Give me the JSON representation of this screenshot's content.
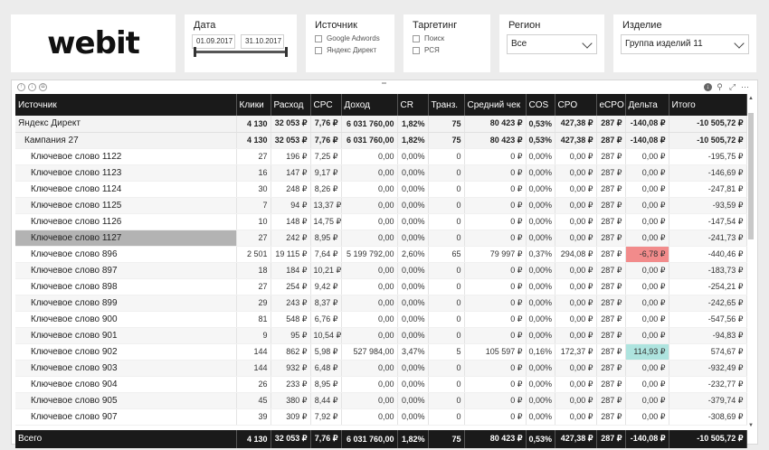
{
  "logo": {
    "text": "webit"
  },
  "date_slicer": {
    "title": "Дата",
    "start": "01.09.2017",
    "end": "31.10.2017"
  },
  "source_slicer": {
    "title": "Источник",
    "options": [
      "Google Adwords",
      "Яндекс Директ"
    ]
  },
  "targeting_slicer": {
    "title": "Таргетинг",
    "options": [
      "Поиск",
      "РСЯ"
    ]
  },
  "region_slicer": {
    "title": "Регион",
    "value": "Все"
  },
  "product_slicer": {
    "title": "Изделие",
    "value": "Группа изделий 11"
  },
  "colors": {
    "header_bg": "#1a1a1a",
    "negative_highlight": "#f28b8b",
    "positive_highlight": "#aee4df",
    "selected_row": "#b3b3b3"
  },
  "table": {
    "columns": [
      "Источник",
      "Клики",
      "Расход",
      "CPC",
      "Доход",
      "CR",
      "Транз.",
      "Средний чек",
      "COS",
      "CPO",
      "eCPO",
      "Дельта",
      "Итого"
    ],
    "rows": [
      {
        "level": 0,
        "cells": [
          "Яндекс Директ",
          "4 130",
          "32 053 ₽",
          "7,76 ₽",
          "6 031 760,00",
          "1,82%",
          "75",
          "80 423 ₽",
          "0,53%",
          "427,38 ₽",
          "287 ₽",
          "-140,08 ₽",
          "-10 505,72 ₽"
        ]
      },
      {
        "level": 1,
        "cells": [
          "Кампания 27",
          "4 130",
          "32 053 ₽",
          "7,76 ₽",
          "6 031 760,00",
          "1,82%",
          "75",
          "80 423 ₽",
          "0,53%",
          "427,38 ₽",
          "287 ₽",
          "-140,08 ₽",
          "-10 505,72 ₽"
        ]
      },
      {
        "level": 2,
        "cells": [
          "Ключевое слово 1122",
          "27",
          "196 ₽",
          "7,25 ₽",
          "0,00",
          "0,00%",
          "0",
          "0 ₽",
          "0,00%",
          "0,00 ₽",
          "287 ₽",
          "0,00 ₽",
          "-195,75 ₽"
        ]
      },
      {
        "level": 2,
        "cells": [
          "Ключевое слово 1123",
          "16",
          "147 ₽",
          "9,17 ₽",
          "0,00",
          "0,00%",
          "0",
          "0 ₽",
          "0,00%",
          "0,00 ₽",
          "287 ₽",
          "0,00 ₽",
          "-146,69 ₽"
        ]
      },
      {
        "level": 2,
        "cells": [
          "Ключевое слово 1124",
          "30",
          "248 ₽",
          "8,26 ₽",
          "0,00",
          "0,00%",
          "0",
          "0 ₽",
          "0,00%",
          "0,00 ₽",
          "287 ₽",
          "0,00 ₽",
          "-247,81 ₽"
        ]
      },
      {
        "level": 2,
        "cells": [
          "Ключевое слово 1125",
          "7",
          "94 ₽",
          "13,37 ₽",
          "0,00",
          "0,00%",
          "0",
          "0 ₽",
          "0,00%",
          "0,00 ₽",
          "287 ₽",
          "0,00 ₽",
          "-93,59 ₽"
        ]
      },
      {
        "level": 2,
        "cells": [
          "Ключевое слово 1126",
          "10",
          "148 ₽",
          "14,75 ₽",
          "0,00",
          "0,00%",
          "0",
          "0 ₽",
          "0,00%",
          "0,00 ₽",
          "287 ₽",
          "0,00 ₽",
          "-147,54 ₽"
        ]
      },
      {
        "level": 2,
        "selected": true,
        "cells": [
          "Ключевое слово 1127",
          "27",
          "242 ₽",
          "8,95 ₽",
          "0,00",
          "0,00%",
          "0",
          "0 ₽",
          "0,00%",
          "0,00 ₽",
          "287 ₽",
          "0,00 ₽",
          "-241,73 ₽"
        ]
      },
      {
        "level": 2,
        "highlight": "neg",
        "cells": [
          "Ключевое слово 896",
          "2 501",
          "19 115 ₽",
          "7,64 ₽",
          "5 199 792,00",
          "2,60%",
          "65",
          "79 997 ₽",
          "0,37%",
          "294,08 ₽",
          "287 ₽",
          "-6,78 ₽",
          "-440,46 ₽"
        ]
      },
      {
        "level": 2,
        "cells": [
          "Ключевое слово 897",
          "18",
          "184 ₽",
          "10,21 ₽",
          "0,00",
          "0,00%",
          "0",
          "0 ₽",
          "0,00%",
          "0,00 ₽",
          "287 ₽",
          "0,00 ₽",
          "-183,73 ₽"
        ]
      },
      {
        "level": 2,
        "cells": [
          "Ключевое слово 898",
          "27",
          "254 ₽",
          "9,42 ₽",
          "0,00",
          "0,00%",
          "0",
          "0 ₽",
          "0,00%",
          "0,00 ₽",
          "287 ₽",
          "0,00 ₽",
          "-254,21 ₽"
        ]
      },
      {
        "level": 2,
        "cells": [
          "Ключевое слово 899",
          "29",
          "243 ₽",
          "8,37 ₽",
          "0,00",
          "0,00%",
          "0",
          "0 ₽",
          "0,00%",
          "0,00 ₽",
          "287 ₽",
          "0,00 ₽",
          "-242,65 ₽"
        ]
      },
      {
        "level": 2,
        "cells": [
          "Ключевое слово 900",
          "81",
          "548 ₽",
          "6,76 ₽",
          "0,00",
          "0,00%",
          "0",
          "0 ₽",
          "0,00%",
          "0,00 ₽",
          "287 ₽",
          "0,00 ₽",
          "-547,56 ₽"
        ]
      },
      {
        "level": 2,
        "cells": [
          "Ключевое слово 901",
          "9",
          "95 ₽",
          "10,54 ₽",
          "0,00",
          "0,00%",
          "0",
          "0 ₽",
          "0,00%",
          "0,00 ₽",
          "287 ₽",
          "0,00 ₽",
          "-94,83 ₽"
        ]
      },
      {
        "level": 2,
        "highlight": "pos",
        "cells": [
          "Ключевое слово 902",
          "144",
          "862 ₽",
          "5,98 ₽",
          "527 984,00",
          "3,47%",
          "5",
          "105 597 ₽",
          "0,16%",
          "172,37 ₽",
          "287 ₽",
          "114,93 ₽",
          "574,67 ₽"
        ]
      },
      {
        "level": 2,
        "cells": [
          "Ключевое слово 903",
          "144",
          "932 ₽",
          "6,48 ₽",
          "0,00",
          "0,00%",
          "0",
          "0 ₽",
          "0,00%",
          "0,00 ₽",
          "287 ₽",
          "0,00 ₽",
          "-932,49 ₽"
        ]
      },
      {
        "level": 2,
        "cells": [
          "Ключевое слово 904",
          "26",
          "233 ₽",
          "8,95 ₽",
          "0,00",
          "0,00%",
          "0",
          "0 ₽",
          "0,00%",
          "0,00 ₽",
          "287 ₽",
          "0,00 ₽",
          "-232,77 ₽"
        ]
      },
      {
        "level": 2,
        "cells": [
          "Ключевое слово 905",
          "45",
          "380 ₽",
          "8,44 ₽",
          "0,00",
          "0,00%",
          "0",
          "0 ₽",
          "0,00%",
          "0,00 ₽",
          "287 ₽",
          "0,00 ₽",
          "-379,74 ₽"
        ]
      },
      {
        "level": 2,
        "cells": [
          "Ключевое слово 907",
          "39",
          "309 ₽",
          "7,92 ₽",
          "0,00",
          "0,00%",
          "0",
          "0 ₽",
          "0,00%",
          "0,00 ₽",
          "287 ₽",
          "0,00 ₽",
          "-308,69 ₽"
        ]
      }
    ],
    "total": [
      "Всего",
      "4 130",
      "32 053 ₽",
      "7,76 ₽",
      "6 031 760,00",
      "1,82%",
      "75",
      "80 423 ₽",
      "0,53%",
      "427,38 ₽",
      "287 ₽",
      "-140,08 ₽",
      "-10 505,72 ₽"
    ]
  }
}
